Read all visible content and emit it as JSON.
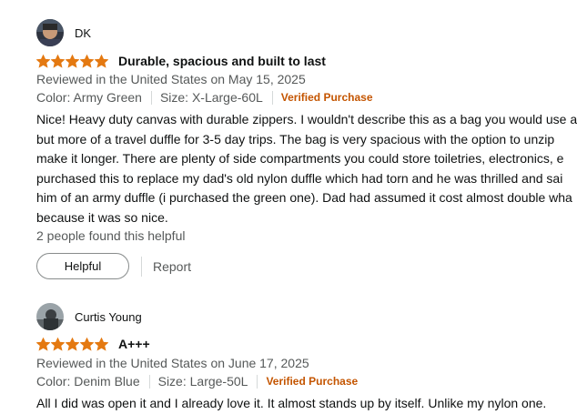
{
  "colors": {
    "star": "#e47911",
    "verified": "#c45500",
    "secondary_text": "#565959"
  },
  "reviews": [
    {
      "reviewer": "DK",
      "rating": 5,
      "title": "Durable, spacious and built to last",
      "reviewed_in": "Reviewed in the United States on May 15, 2025",
      "color": "Color: Army Green",
      "size": "Size: X-Large-60L",
      "verified": "Verified Purchase",
      "body_lines": [
        "Nice! Heavy duty canvas with durable zippers. I wouldn't describe this as a bag you would use a",
        "but more of a travel duffle for 3-5 day trips. The bag is very spacious with the option to unzip",
        "make it longer. There are plenty of side compartments you could store toiletries, electronics, e",
        "purchased this to replace my dad's old nylon duffle which had torn and he was thrilled and sai",
        "him of an army duffle (i purchased the green one). Dad had assumed it cost almost double wha",
        "because it was so nice."
      ],
      "helpful_count": "2 people found this helpful",
      "helpful_button": "Helpful",
      "report_link": "Report"
    },
    {
      "reviewer": "Curtis Young",
      "rating": 5,
      "title": "A+++",
      "reviewed_in": "Reviewed in the United States on June 17, 2025",
      "color": "Color: Denim Blue",
      "size": "Size: Large-50L",
      "verified": "Verified Purchase",
      "body_lines": [
        "All I did was open it and I already love it. It almost stands up by itself. Unlike my nylon one."
      ]
    }
  ]
}
